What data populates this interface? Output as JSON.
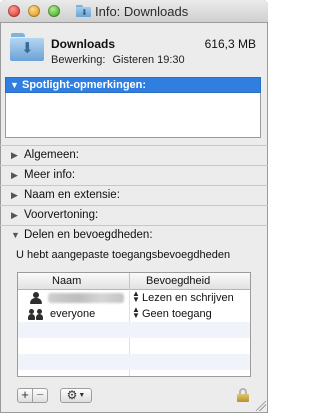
{
  "window": {
    "title": "Info: Downloads"
  },
  "header": {
    "name": "Downloads",
    "size": "616,3 MB",
    "modified_label": "Bewerking:",
    "modified_value": "Gisteren 19:30"
  },
  "spotlight": {
    "label": "Spotlight-opmerkingen:",
    "comment": ""
  },
  "sections": [
    {
      "label": "Algemeen:",
      "expanded": false
    },
    {
      "label": "Meer info:",
      "expanded": false
    },
    {
      "label": "Naam en extensie:",
      "expanded": false
    },
    {
      "label": "Voorvertoning:",
      "expanded": false
    },
    {
      "label": "Delen en bevoegdheden:",
      "expanded": true
    }
  ],
  "sharing": {
    "description": "U hebt aangepaste toegangsbevoegdheden",
    "columns": {
      "name": "Naam",
      "privilege": "Bevoegdheid"
    },
    "rows": [
      {
        "name": "",
        "name_redacted": true,
        "icon": "person-icon",
        "privilege": "Lezen en schrijven"
      },
      {
        "name": "everyone",
        "icon": "group-icon",
        "privilege": "Geen toegang"
      }
    ]
  },
  "toolbar": {
    "add_label": "+",
    "remove_label": "−",
    "action_label": "⚙",
    "action_chevron": "▼"
  },
  "icons": {
    "title": "downloads-folder-icon",
    "header": "downloads-folder-icon",
    "lock": "lock-icon"
  },
  "colors": {
    "accent": "#2f7ee0",
    "window_bg": "#ececec"
  }
}
